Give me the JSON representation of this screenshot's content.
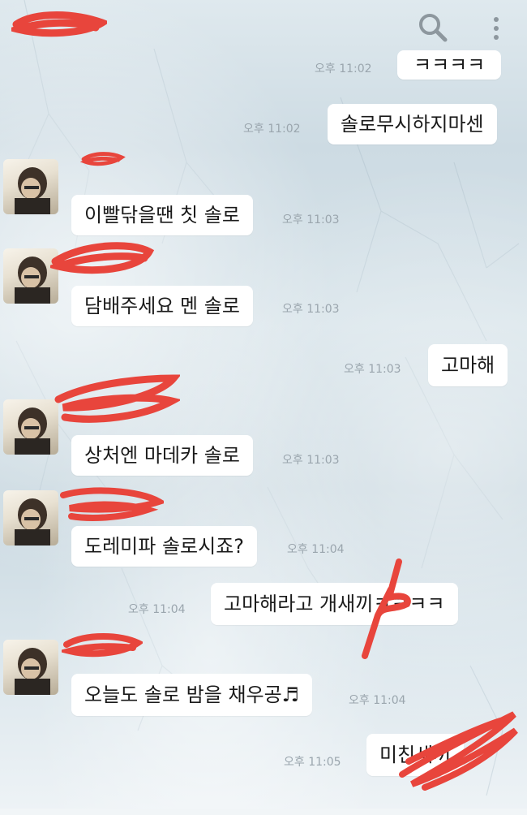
{
  "header": {
    "search_icon": "search-icon",
    "more_icon": "more-vertical-icon"
  },
  "colors": {
    "bubble": "#ffffff",
    "timestamp": "#9aa5ad",
    "redaction": "#e8453c"
  },
  "messages": [
    {
      "side": "right",
      "text": "ㅋㅋㅋㅋ",
      "time": "오후 11:02"
    },
    {
      "side": "right",
      "text": "솔로무시하지마센",
      "time": "오후 11:02"
    },
    {
      "side": "left",
      "text": "이빨닦을땐 칫 솔로",
      "time": "오후 11:03"
    },
    {
      "side": "left",
      "text": "담배주세요 멘 솔로",
      "time": "오후 11:03"
    },
    {
      "side": "right",
      "text": "고마해",
      "time": "오후 11:03"
    },
    {
      "side": "left",
      "text": "상처엔 마데카 솔로",
      "time": "오후 11:03"
    },
    {
      "side": "left",
      "text": "도레미파 솔로시죠?",
      "time": "오후 11:04"
    },
    {
      "side": "right",
      "text": "고마해라고 개새끼ㅋㅋㅋㅋ",
      "time": "오후 11:04"
    },
    {
      "side": "left",
      "text": "오늘도 솔로 밤을 채우공♬",
      "time": "오후 11:04"
    },
    {
      "side": "right",
      "text": "미친새끼",
      "time": "오후 11:05"
    }
  ]
}
